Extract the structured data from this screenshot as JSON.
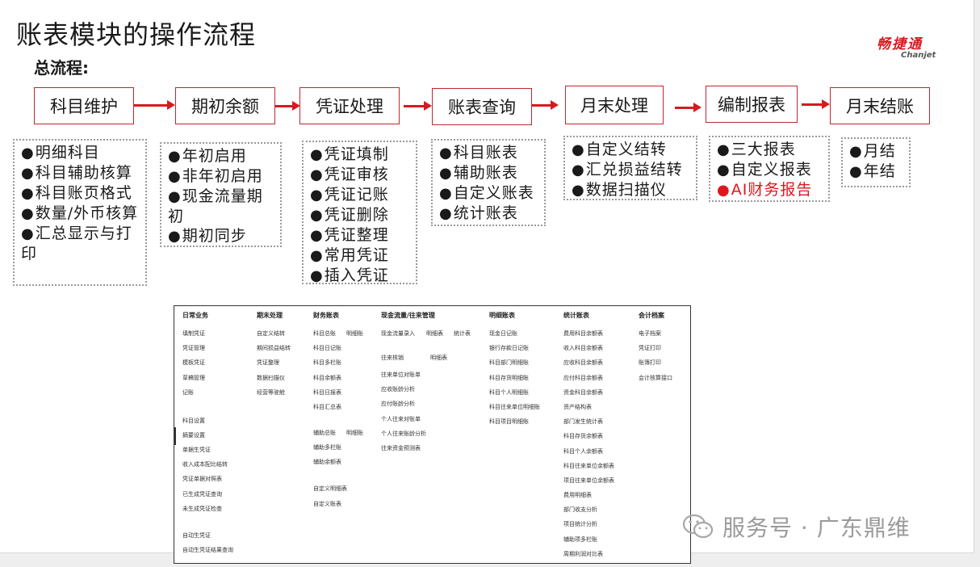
{
  "title": "账表模块的操作流程",
  "subtitle": "总流程:",
  "logo": {
    "cn": "畅捷通",
    "en": "Chanjet"
  },
  "steps": [
    "科目维护",
    "期初余额",
    "凭证处理",
    "账表查询",
    "月末处理",
    "编制报表",
    "月末结账"
  ],
  "bullet": "●",
  "boxes": [
    [
      "明细科目",
      "科目辅助核算",
      "科目账页格式",
      "数量/外币核算",
      "汇总显示与打印"
    ],
    [
      "年初启用",
      "非年初启用",
      "现金流量期初",
      "期初同步"
    ],
    [
      "凭证填制",
      "凭证审核",
      "凭证记账",
      "凭证删除",
      "凭证整理",
      "常用凭证",
      "插入凭证"
    ],
    [
      "科目账表",
      "辅助账表",
      "自定义账表",
      "统计账表"
    ],
    [
      "自定义结转",
      "汇兑损益结转",
      "数据扫描仪"
    ],
    [
      "三大报表",
      "自定义报表",
      "AI财务报告"
    ],
    [
      "月结",
      "年结"
    ]
  ],
  "highlight_color": "#e0161c",
  "menu": {
    "columns": [
      {
        "header": "日常业务",
        "items": [
          "填制凭证",
          "凭证管理",
          "模板凭证",
          "草稿管理",
          "记账",
          "科目设置",
          "摘要设置",
          "单据生凭证",
          "收入成本配比结转",
          "凭证单据对照表",
          "已生成凭证查询",
          "未生成凭证检查",
          "自动生凭证",
          "自动生凭证结果查询"
        ]
      },
      {
        "header": "期末处理",
        "items": [
          "自定义结转",
          "期间损益结转",
          "凭证整理",
          "数据扫描仪",
          "经营等驶舱"
        ]
      },
      {
        "header": "财务账表",
        "items": [
          "科目总账",
          "明细账",
          "科目日记账",
          "科目多栏账",
          "科目余额表",
          "科目日报表",
          "科目汇总表",
          "辅助总账",
          "明细账",
          "辅助多栏账",
          "辅助余额表",
          "自定义明细表",
          "自定义账表"
        ]
      },
      {
        "header": "现金流量/往来管理",
        "items": [
          "现金流量录入",
          "明细表",
          "统计表",
          "往来核销",
          "明细表",
          "往来单位对账单",
          "应收账龄分析",
          "应付账龄分析",
          "个人往来对账单",
          "个人往来账龄分析",
          "往来资金预测表"
        ]
      },
      {
        "header": "明细账表",
        "items": [
          "现金日记账",
          "银行存款日记账",
          "科目部门明细账",
          "科目存货明细账",
          "科目个人明细账",
          "科目往来单位明细账",
          "科目项目明细账"
        ]
      },
      {
        "header": "统计账表",
        "items": [
          "费用科目余额表",
          "收入科目余额表",
          "应收科目余额表",
          "应付科目余额表",
          "资金科目余额表",
          "资产结构表",
          "部门发生统计表",
          "科目存货余额表",
          "科目个人余额表",
          "科目往来单位余额表",
          "项目往来单位余额表",
          "费用明细表",
          "部门收支分析",
          "项目统计分析",
          "辅助项多栏账",
          "周期利润对比表"
        ]
      },
      {
        "header": "会计档案",
        "items": [
          "电子档案",
          "凭证打印",
          "账簿打印",
          "会计核算接口"
        ]
      }
    ]
  },
  "watermark": "服务号 · 广东鼎维"
}
